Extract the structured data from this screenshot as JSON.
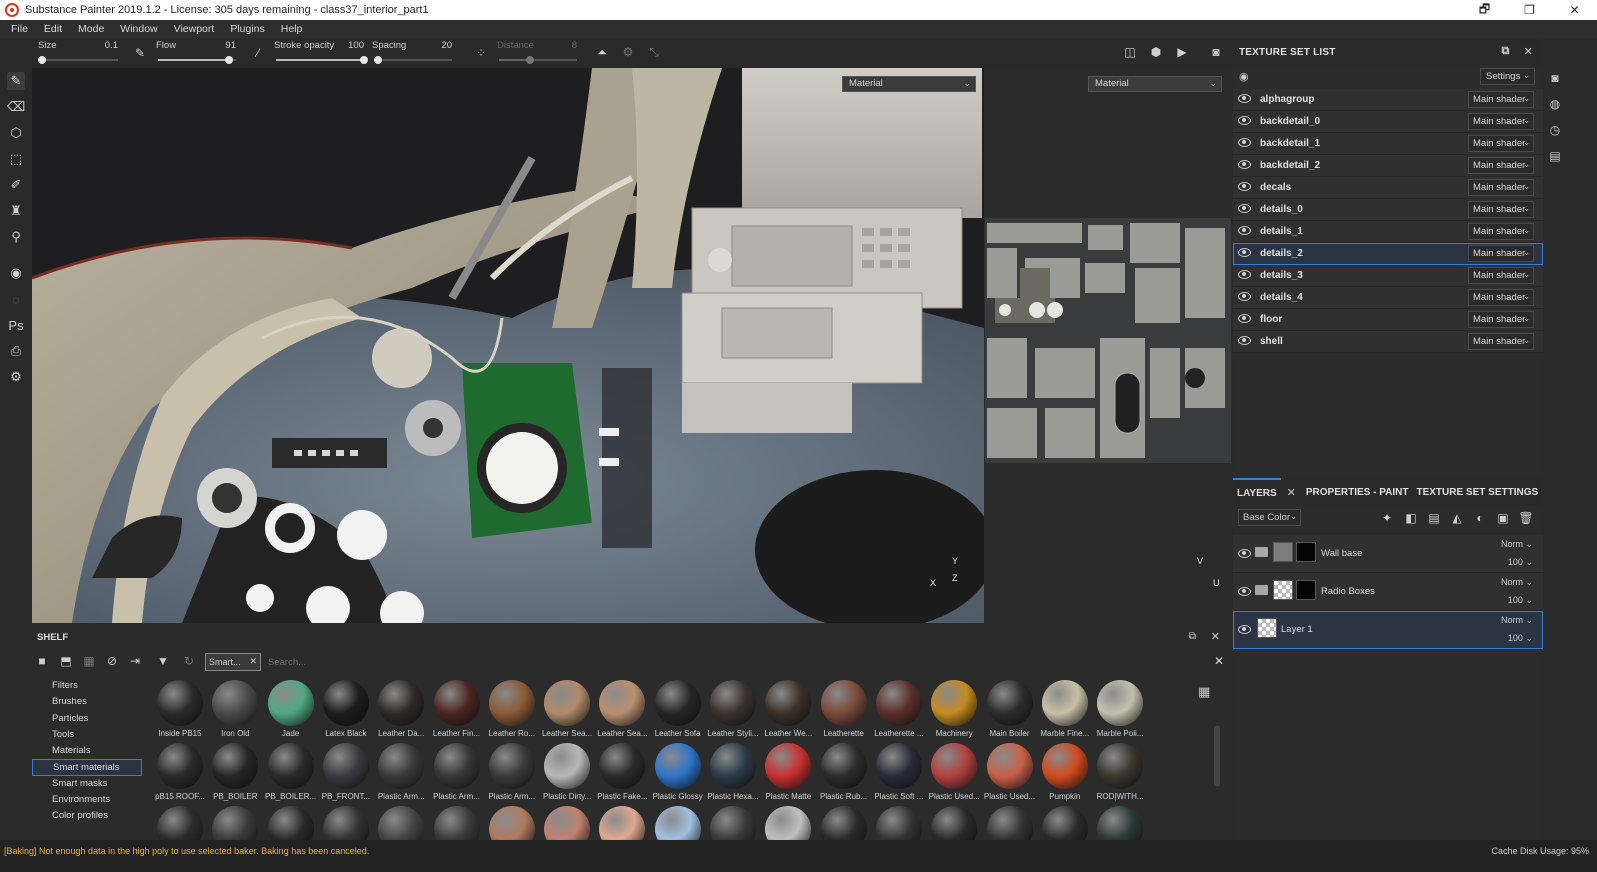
{
  "window": {
    "title": "Substance Painter 2019.1.2 - License: 305 days remaining - class37_interior_part1",
    "controls": [
      "🗗",
      "❐",
      "✕"
    ]
  },
  "menu": [
    "File",
    "Edit",
    "Mode",
    "Window",
    "Viewport",
    "Plugins",
    "Help"
  ],
  "tool_props": {
    "size": {
      "label": "Size",
      "value": "0.1",
      "level": 0.02
    },
    "flow": {
      "label": "Flow",
      "value": "91",
      "level": 0.91
    },
    "stroke_opacity": {
      "label": "Stroke opacity",
      "value": "100",
      "level": 1.0
    },
    "spacing": {
      "label": "Spacing",
      "value": "20",
      "level": 0.05
    },
    "distance": {
      "label": "Distance",
      "value": "8",
      "level": 0.4
    }
  },
  "viewport": {
    "dropdown_3d": "Material",
    "dropdown_2d": "Material",
    "gizmo_3d": {
      "x": "X",
      "y": "Y",
      "z": "Z"
    },
    "gizmo_2d": {
      "v": "V",
      "u": "U"
    }
  },
  "texture_set_list": {
    "title": "TEXTURE SET LIST",
    "settings_label": "Settings",
    "shader_label": "Main shader",
    "items": [
      {
        "name": "alphagroup",
        "selected": false
      },
      {
        "name": "backdetail_0",
        "selected": false
      },
      {
        "name": "backdetail_1",
        "selected": false
      },
      {
        "name": "backdetail_2",
        "selected": false
      },
      {
        "name": "decals",
        "selected": false
      },
      {
        "name": "details_0",
        "selected": false
      },
      {
        "name": "details_1",
        "selected": false
      },
      {
        "name": "details_2",
        "selected": true
      },
      {
        "name": "details_3",
        "selected": false
      },
      {
        "name": "details_4",
        "selected": false
      },
      {
        "name": "floor",
        "selected": false
      },
      {
        "name": "shell",
        "selected": false
      }
    ]
  },
  "layers": {
    "tabs": [
      "LAYERS",
      "PROPERTIES - PAINT",
      "TEXTURE SET SETTINGS"
    ],
    "close": "✕",
    "channel": "Base Color",
    "items": [
      {
        "name": "Wall base",
        "blend": "Norm",
        "opacity": "100",
        "folder": true
      },
      {
        "name": "Radio Boxes",
        "blend": "Norm",
        "opacity": "100",
        "folder": true
      },
      {
        "name": "Layer 1",
        "blend": "Norm",
        "opacity": "100",
        "folder": false
      }
    ]
  },
  "shelf": {
    "title": "SHELF",
    "filter_tag": "Smart...",
    "search_placeholder": "Search...",
    "categories": [
      "Filters",
      "Brushes",
      "Particles",
      "Tools",
      "Materials",
      "Smart materials",
      "Smart masks",
      "Environments",
      "Color profiles"
    ],
    "active_category": "Smart materials",
    "row1": [
      {
        "name": "Inside PB15",
        "color": "#2a2a2a"
      },
      {
        "name": "Iron Old",
        "color": "#4a4a4a"
      },
      {
        "name": "Jade",
        "color": "#4fa884"
      },
      {
        "name": "Latex Black",
        "color": "#1c1c1c"
      },
      {
        "name": "Leather Da...",
        "color": "#2e2a28"
      },
      {
        "name": "Leather Fin...",
        "color": "#4a2622"
      },
      {
        "name": "Leather Ro...",
        "color": "#8a5a36"
      },
      {
        "name": "Leather Sea...",
        "color": "#b08a6a"
      },
      {
        "name": "Leather Sea...",
        "color": "#b89070"
      },
      {
        "name": "Leather Sofa",
        "color": "#262626"
      },
      {
        "name": "Leather Styli...",
        "color": "#3a3230"
      },
      {
        "name": "Leather We...",
        "color": "#3c3028"
      },
      {
        "name": "Leatherette",
        "color": "#7a4a3c"
      },
      {
        "name": "Leatherette ...",
        "color": "#5a2e2a"
      },
      {
        "name": "Machinery",
        "color": "#c48a20"
      },
      {
        "name": "Main Boiler",
        "color": "#2c2c2c"
      },
      {
        "name": "Marble Fine...",
        "color": "#c8c0a6"
      },
      {
        "name": "Marble Poli...",
        "color": "#c4c0b0"
      }
    ],
    "row2": [
      {
        "name": "pB15 ROOF...",
        "color": "#2a2a2a"
      },
      {
        "name": "PB_BOILER",
        "color": "#262626"
      },
      {
        "name": "PB_BOILER...",
        "color": "#2a2a2a"
      },
      {
        "name": "PB_FRONT...",
        "color": "#3a3a40"
      },
      {
        "name": "Plastic Arm...",
        "color": "#3a3a3a"
      },
      {
        "name": "Plastic Arm...",
        "color": "#363636"
      },
      {
        "name": "Plastic Arm...",
        "color": "#3a3a3a"
      },
      {
        "name": "Plastic Dirty...",
        "color": "#b8b8b8"
      },
      {
        "name": "Plastic Fake...",
        "color": "#2a2a2a"
      },
      {
        "name": "Plastic Glossy",
        "color": "#2d74c8"
      },
      {
        "name": "Plastic Hexa...",
        "color": "#2a3a48"
      },
      {
        "name": "Plastic Matte",
        "color": "#c83030"
      },
      {
        "name": "Plastic Rub...",
        "color": "#2c2c2c"
      },
      {
        "name": "Plastic Soft ...",
        "color": "#2a2a3a"
      },
      {
        "name": "Plastic Used...",
        "color": "#b04040"
      },
      {
        "name": "Plastic Used...",
        "color": "#c86048"
      },
      {
        "name": "Pumpkin",
        "color": "#d04a1e"
      },
      {
        "name": "ROD|WITH...",
        "color": "#3a3630"
      }
    ],
    "row3_colors": [
      "#2c2c2c",
      "#3a3a3a",
      "#2a2a2a",
      "#333",
      "#444",
      "#3a3a3a",
      "#b07a60",
      "#c08070",
      "#e0a890",
      "#a0c0e0",
      "#3a3a3a",
      "#c0c0c0",
      "#2a2a2a",
      "#333",
      "#2a2a2a",
      "#333",
      "#2a2a2a",
      "#2a3a36"
    ]
  },
  "status": {
    "message": "[Baking] Not enough data in the high poly to use selected baker. Baking has been canceled.",
    "cache": "Cache Disk Usage:   95%"
  },
  "colors": {
    "accent": "#3f7ad8",
    "warning": "#e8b33a"
  }
}
